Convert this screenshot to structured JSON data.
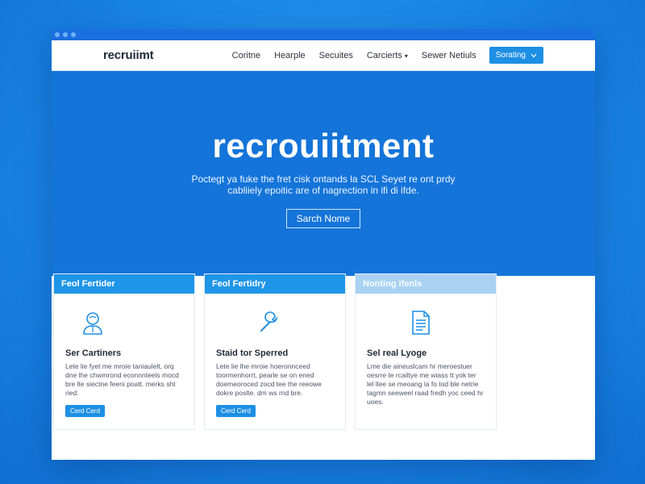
{
  "nav": {
    "logo": "recruiimt",
    "items": [
      {
        "label": "Coritne"
      },
      {
        "label": "Hearple"
      },
      {
        "label": "Secuites"
      },
      {
        "label": "Carcierts",
        "dropdown": true
      },
      {
        "label": "Sewer Netiuls"
      }
    ],
    "button_label": "Sorating"
  },
  "hero": {
    "title": "recrouiitment",
    "subtitle": "Poctegt ya fuke the fret cisk ontands la SCL Seyet re ont prdy cabliiely epoitic are of nagrection in ifi di ifde.",
    "button_label": "Sarch Nome"
  },
  "cards": [
    {
      "header": "Feol Fertider",
      "icon": "person-icon",
      "title": "Ser Cartiners",
      "body": "Lete lie fyet me mroie taniaulelt, orq dne lhe chwmrond econnnteels mocd bre lte siectne feeni poatt. merks sht ried.",
      "button_label": "Cerd Cerd"
    },
    {
      "header": "Feol Fertidry",
      "icon": "wrench-icon",
      "title": "Staid tor Sperred",
      "body": "Lete lie lhe mroie hoeronnceed toormenhorrt, pearle se on ened doemeoroced zocd tee the reeowe dokre poslte. dm ws rnd bre.",
      "button_label": "Cerd Cerd"
    },
    {
      "header": "Nonting Ifenls",
      "icon": "document-icon",
      "title": "Sel real Lyoge",
      "body": "Lme die aineuslcam hr meroestuer oesrre te rcailtye me wiass tt yok ter lel llee se meoang la fo tod ble netrie tagmn seeweel raad fredh yoc ceed hr uoes.",
      "button_label": ""
    }
  ],
  "colors": {
    "accent": "#1d8fe4",
    "hero_bg": "#1474d9",
    "light_header": "#a9d2f2"
  }
}
